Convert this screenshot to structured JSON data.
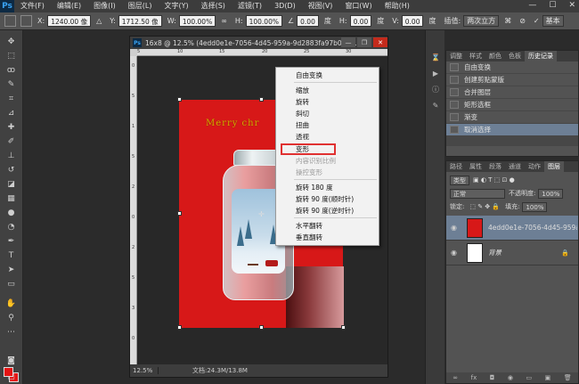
{
  "menubar": {
    "logo": "Ps",
    "items": [
      "文件(F)",
      "编辑(E)",
      "图像(I)",
      "图层(L)",
      "文字(Y)",
      "选择(S)",
      "滤镜(T)",
      "3D(D)",
      "视图(V)",
      "窗口(W)",
      "帮助(H)"
    ],
    "window_buttons": [
      "—",
      "☐",
      "✕"
    ]
  },
  "options": {
    "x_label": "X:",
    "x_value": "1240.00 像",
    "y_label": "Y:",
    "y_value": "1712.50 像",
    "w_label": "W:",
    "w_value": "100.00%",
    "h_label": "H:",
    "h_value": "100.00%",
    "angle_value": "0.00",
    "angle_unit": "度",
    "hskew_label": "H:",
    "hskew_value": "0.00",
    "hskew_unit": "度",
    "vskew_label": "V:",
    "vskew_value": "0.00",
    "vskew_unit": "度",
    "interp_label": "插值:",
    "interp_value": "两次立方",
    "workspace": "基本"
  },
  "document": {
    "title": "16x8 @ 12.5% (4edd0e1e-7056-4d45-959a-9d2883fa97b0, R...",
    "zoom": "12.5%",
    "info": "文档:24.3M/13.8M",
    "ruler_h": [
      "5",
      "10",
      "15",
      "20",
      "25",
      "30"
    ],
    "ruler_v": [
      "0",
      "5",
      "1",
      "5",
      "2",
      "0",
      "2",
      "5",
      "3",
      "0"
    ],
    "canvas_text": "Merry chr"
  },
  "context_menu": {
    "items": [
      {
        "label": "自由变换",
        "disabled": false
      },
      {
        "label": "缩放",
        "disabled": false
      },
      {
        "label": "旋转",
        "disabled": false
      },
      {
        "label": "斜切",
        "disabled": false
      },
      {
        "label": "扭曲",
        "disabled": false
      },
      {
        "label": "透视",
        "disabled": false
      },
      {
        "label": "变形",
        "disabled": false
      },
      {
        "label": "内容识别比例",
        "disabled": true
      },
      {
        "label": "操控变形",
        "disabled": true
      },
      {
        "label": "旋转 180 度",
        "disabled": false
      },
      {
        "label": "旋转 90 度(顺时针)",
        "disabled": false
      },
      {
        "label": "旋转 90 度(逆时针)",
        "disabled": false
      },
      {
        "label": "水平翻转",
        "disabled": false
      },
      {
        "label": "垂直翻转",
        "disabled": false
      }
    ]
  },
  "history_panel": {
    "tabs": [
      "调整",
      "样式",
      "颜色",
      "色板",
      "历史记录"
    ],
    "items": [
      "自由变换",
      "创建剪贴蒙版",
      "合并图层",
      "矩形选框",
      "渐变",
      "取消选择"
    ]
  },
  "layers_panel": {
    "tabs": [
      "路径",
      "属性",
      "段落",
      "通道",
      "动作",
      "图层"
    ],
    "filter_label": "类型",
    "blend_mode": "正常",
    "opacity_label": "不透明度:",
    "opacity_value": "100%",
    "lock_label": "锁定:",
    "fill_label": "填充:",
    "fill_value": "100%",
    "layers": [
      {
        "name": "4edd0e1e-7056-4d45-959a-...",
        "active": true
      },
      {
        "name": "背景",
        "active": false
      }
    ],
    "bottom_icons": [
      "∞",
      "fx",
      "◘",
      "◉",
      "▭",
      "▣",
      "🗑"
    ]
  },
  "colors": {
    "foreground": "#e51414",
    "background": "#e51414",
    "canvas_red": "#d71818",
    "highlight_box": "#e03131"
  }
}
